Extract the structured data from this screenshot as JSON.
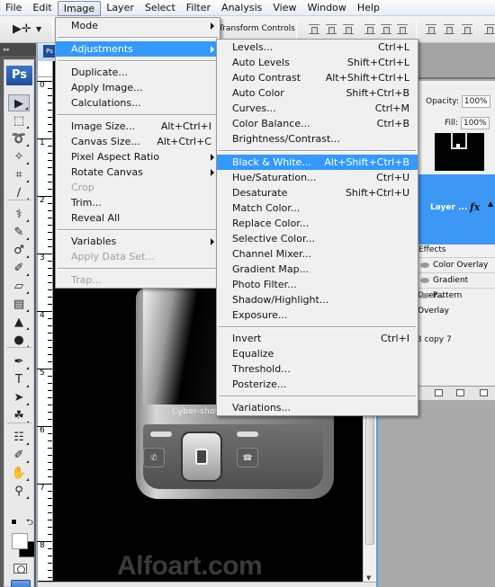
{
  "menubar": {
    "items": [
      "File",
      "Edit",
      "Image",
      "Layer",
      "Select",
      "Filter",
      "Analysis",
      "View",
      "Window",
      "Help"
    ],
    "active_index": 2
  },
  "options_bar": {
    "tool_icon": "move-tool-icon",
    "transform_controls_label": "Transform Controls"
  },
  "toolbar": {
    "logo": "Ps",
    "tools": [
      "move",
      "rectangular-marquee",
      "lasso",
      "magic-wand",
      "crop",
      "slice",
      "healing-brush",
      "brush",
      "clone-stamp",
      "history-brush",
      "eraser",
      "gradient",
      "blur",
      "dodge",
      "pen",
      "type",
      "path-selection",
      "custom-shape",
      "notes",
      "eyedropper",
      "hand",
      "zoom"
    ],
    "foreground_color": "#ffffff",
    "background_color": "#000000"
  },
  "document": {
    "tab_icon": "Ps",
    "ruler_numbers": [
      "0",
      "1",
      "2",
      "3",
      "4",
      "5",
      "6",
      "7",
      "8"
    ],
    "phone_brand": "Cyber-shot",
    "watermark": "Alfoart.com",
    "background_color": "#000000"
  },
  "image_menu": {
    "items": [
      {
        "label": "Mode",
        "submenu": true
      },
      {
        "sep": true
      },
      {
        "label": "Adjustments",
        "submenu": true,
        "highlighted": true
      },
      {
        "sep": true
      },
      {
        "label": "Duplicate..."
      },
      {
        "label": "Apply Image..."
      },
      {
        "label": "Calculations..."
      },
      {
        "sep": true
      },
      {
        "label": "Image Size...",
        "shortcut": "Alt+Ctrl+I"
      },
      {
        "label": "Canvas Size...",
        "shortcut": "Alt+Ctrl+C"
      },
      {
        "label": "Pixel Aspect Ratio",
        "submenu": true
      },
      {
        "label": "Rotate Canvas",
        "submenu": true
      },
      {
        "label": "Crop",
        "disabled": true
      },
      {
        "label": "Trim..."
      },
      {
        "label": "Reveal All"
      },
      {
        "sep": true
      },
      {
        "label": "Variables",
        "submenu": true
      },
      {
        "label": "Apply Data Set...",
        "disabled": true
      },
      {
        "sep": true
      },
      {
        "label": "Trap...",
        "disabled": true
      }
    ]
  },
  "adjustments_menu": {
    "items": [
      {
        "label": "Levels...",
        "shortcut": "Ctrl+L"
      },
      {
        "label": "Auto Levels",
        "shortcut": "Shift+Ctrl+L"
      },
      {
        "label": "Auto Contrast",
        "shortcut": "Alt+Shift+Ctrl+L"
      },
      {
        "label": "Auto Color",
        "shortcut": "Shift+Ctrl+B"
      },
      {
        "label": "Curves...",
        "shortcut": "Ctrl+M"
      },
      {
        "label": "Color Balance...",
        "shortcut": "Ctrl+B"
      },
      {
        "label": "Brightness/Contrast..."
      },
      {
        "sep": true
      },
      {
        "label": "Black & White...",
        "shortcut": "Alt+Shift+Ctrl+B",
        "highlighted": true
      },
      {
        "label": "Hue/Saturation...",
        "shortcut": "Ctrl+U"
      },
      {
        "label": "Desaturate",
        "shortcut": "Shift+Ctrl+U"
      },
      {
        "label": "Match Color..."
      },
      {
        "label": "Replace Color..."
      },
      {
        "label": "Selective Color..."
      },
      {
        "label": "Channel Mixer..."
      },
      {
        "label": "Gradient Map..."
      },
      {
        "label": "Photo Filter..."
      },
      {
        "label": "Shadow/Highlight..."
      },
      {
        "label": "Exposure..."
      },
      {
        "sep": true
      },
      {
        "label": "Invert",
        "shortcut": "Ctrl+I"
      },
      {
        "label": "Equalize"
      },
      {
        "label": "Threshold..."
      },
      {
        "label": "Posterize..."
      },
      {
        "sep": true
      },
      {
        "label": "Variations..."
      }
    ]
  },
  "layers_panel": {
    "opacity_label": "Opacity:",
    "opacity_value": "100%",
    "fill_label": "Fill:",
    "fill_value": "100%",
    "selected_layer_name": "Layer ...",
    "fx_label": "fx",
    "effects_label": "Effects",
    "effects": [
      "Color Overlay",
      "Gradient Over...",
      "Pattern Overlay"
    ],
    "other_layer_name": "3 copy 7",
    "accent_color": "#3d97f5"
  },
  "colors": {
    "menu_highlight": "#3399ff",
    "menu_bg": "#f0f0f0"
  }
}
